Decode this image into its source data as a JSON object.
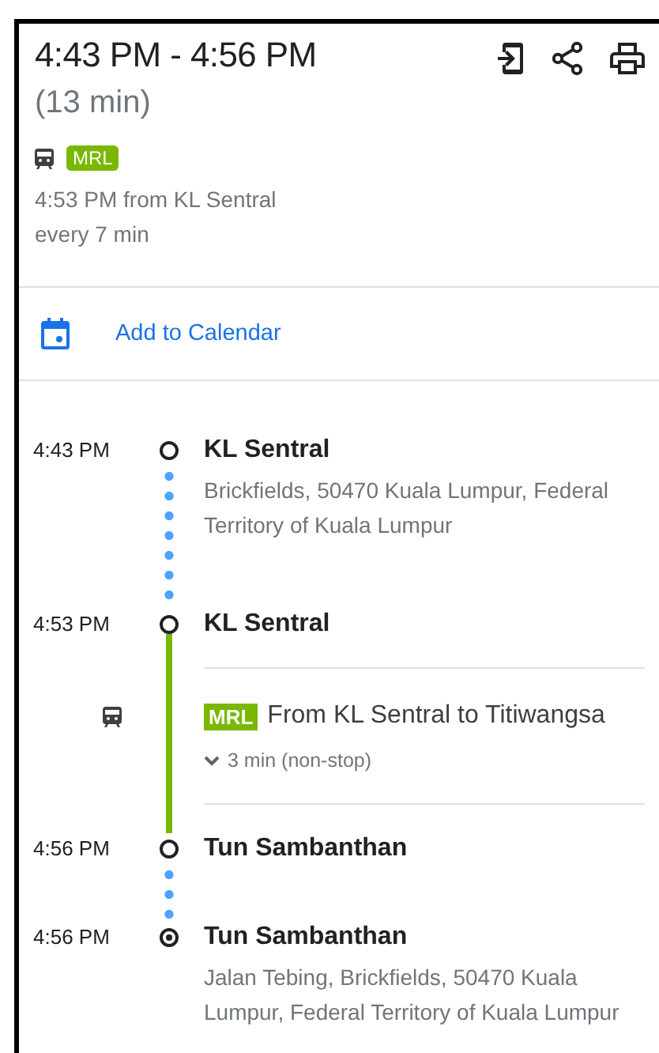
{
  "header": {
    "time_range": "4:43 PM - 4:56 PM",
    "duration": "(13 min)",
    "line_badge": {
      "label": "MRL",
      "color": "#7ab800"
    },
    "departure": "4:53 PM from KL Sentral",
    "frequency": "every 7 min"
  },
  "actions": [
    {
      "label": "Add to Calendar"
    }
  ],
  "timeline": [
    {
      "kind": "stop",
      "time": "4:43 PM",
      "name": "KL Sentral",
      "address": "Brickfields, 50470 Kuala Lumpur, Federal Territory of Kuala Lumpur",
      "destination": false,
      "walk_after": true
    },
    {
      "kind": "stop",
      "time": "4:53 PM",
      "name": "KL Sentral",
      "destination": false,
      "walk_after": false
    },
    {
      "kind": "transit",
      "badge": "MRL",
      "color": "#7ab800",
      "text": "From KL Sentral to Titiwangsa",
      "detail": "3 min (non-stop)",
      "expanded": false
    },
    {
      "kind": "stop",
      "time": "4:56 PM",
      "name": "Tun Sambanthan",
      "destination": false,
      "walk_after": true
    },
    {
      "kind": "stop",
      "time": "4:56 PM",
      "name": "Tun Sambanthan",
      "address": "Jalan Tebing, Brickfields, 50470 Kuala Lumpur, Federal Territory of Kuala Lumpur",
      "destination": true,
      "walk_after": false
    }
  ]
}
